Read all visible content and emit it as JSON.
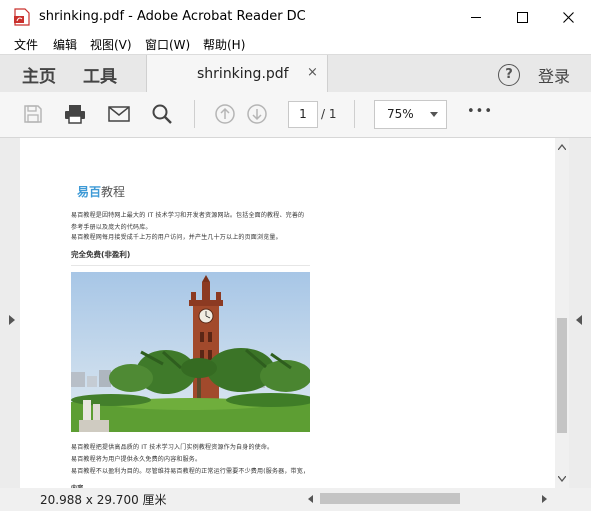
{
  "window": {
    "title": "shrinking.pdf - Adobe Acrobat Reader DC",
    "controls": [
      "minimize-icon",
      "maximize-icon",
      "close-icon"
    ]
  },
  "menu": {
    "items": [
      "文件",
      "编辑",
      "视图(V)",
      "窗口(W)",
      "帮助(H)"
    ]
  },
  "tabs": {
    "home": "主页",
    "tools": "工具",
    "document": "shrinking.pdf",
    "close": "×",
    "help_icon": "?",
    "login": "登录"
  },
  "toolbar": {
    "icons": [
      "save-icon",
      "print-icon",
      "email-icon",
      "search-icon",
      "page-up-icon",
      "page-down-icon",
      "more-icon"
    ],
    "page_current": "1",
    "page_total": "/ 1",
    "zoom": "75%",
    "more": "•••"
  },
  "document": {
    "logo_brand": "易百",
    "logo_rest": "教程",
    "intro_lines": [
      "易百教程是因特网上最大的 IT 技术学习和开发者资源网站。包括全面的教程、完善的",
      "参考手册以及庞大的代码库。",
      "易百教程网每月接受成千上万的用户访问，并产生几十万以上的页面浏览量。"
    ],
    "section_heading": "完全免费(非盈利)",
    "photo": "clock-tower-photo",
    "body_lines": [
      "易百教程把提供高品质的 IT 技术学习入门实例教程资源作为自身的使命。",
      "易百教程将为用户提供永久免费的内容和服务。",
      "易百教程不以盈利为目的。尽管维持易百教程的正常运行需要不少费用(服务器，带宽，"
    ],
    "cut_off_line": "内容..."
  },
  "status": {
    "page_size": "20.988 x 29.700 厘米"
  },
  "colors": {
    "brand_blue": "#3e9ad6",
    "chrome": "#f6f6f6",
    "tab_bar": "#e8e8e8"
  }
}
